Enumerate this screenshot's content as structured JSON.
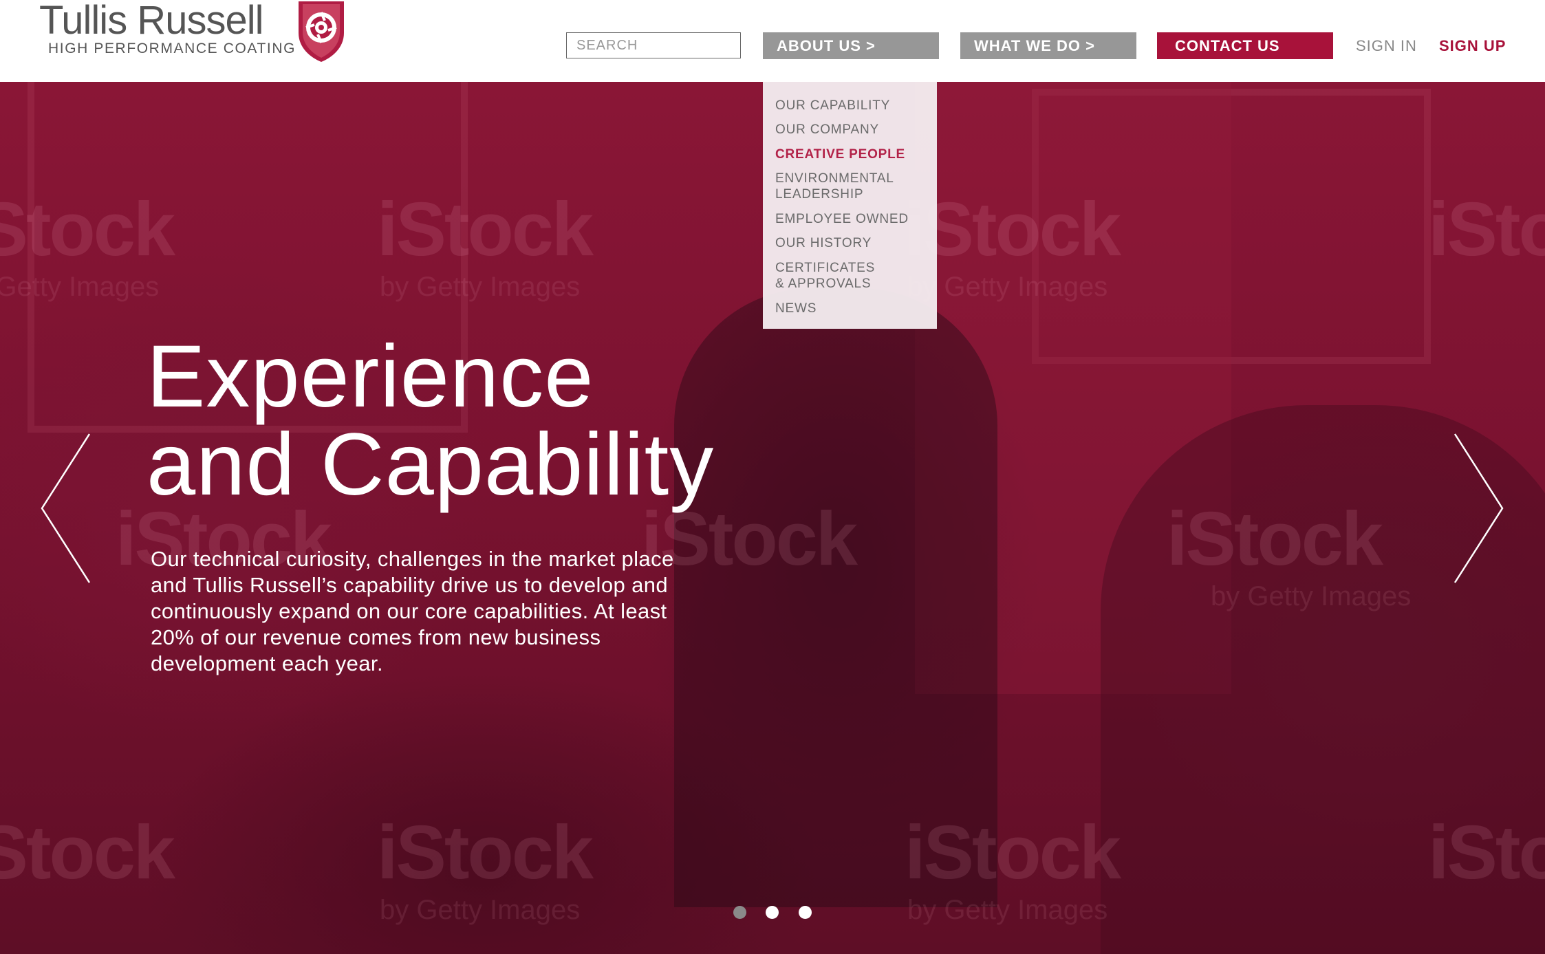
{
  "brand": {
    "name": "Tullis Russell",
    "tagline": "HIGH PERFORMANCE COATING",
    "accent_color": "#a8123a"
  },
  "header": {
    "search": {
      "placeholder": "SEARCH",
      "value": ""
    },
    "nav": {
      "about": "ABOUT US >",
      "what": "WHAT WE DO >",
      "contact": "CONTACT US",
      "signin": "SIGN IN",
      "signup": "SIGN UP"
    }
  },
  "dropdown": {
    "items": [
      {
        "label": "OUR CAPABILITY"
      },
      {
        "label": "OUR COMPANY"
      },
      {
        "label": "CREATIVE PEOPLE",
        "active": true
      },
      {
        "label": "ENVIRONMENTAL",
        "label2": "LEADERSHIP"
      },
      {
        "label": "EMPLOYEE OWNED"
      },
      {
        "label": "OUR HISTORY"
      },
      {
        "label": "CERTIFICATES",
        "label2": "& APPROVALS"
      },
      {
        "label": "NEWS"
      }
    ]
  },
  "hero": {
    "title_line1": "Experience",
    "title_line2": "and Capability",
    "body_lines": [
      "Our technical curiosity, challenges in the market place",
      "and Tullis Russell’s capability drive us to develop and",
      "continuously expand on our core capabilities. At least",
      "20% of our revenue comes from new business",
      "development each year."
    ],
    "watermark": "iStock",
    "watermark_sub": "by Getty Images",
    "slides_total": 3,
    "active_slide": 2,
    "icons": {
      "prev": "chevron-left-icon",
      "next": "chevron-right-icon"
    }
  }
}
